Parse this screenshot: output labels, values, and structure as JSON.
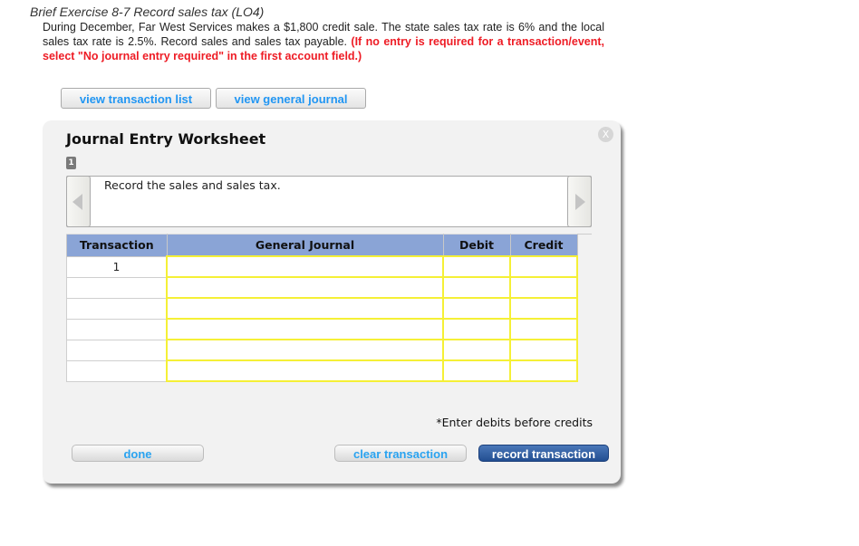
{
  "exercise": {
    "title": "Brief Exercise 8-7 Record sales tax (LO4)",
    "body": "During December, Far West Services makes a $1,800 credit sale. The state sales tax rate is 6% and the local sales tax rate is 2.5%. Record sales and sales tax payable.",
    "instruction": "(If no entry is required for a transaction/event, select \"No journal entry required\" in the first account field.)",
    "instruction_color": "#ee1c25"
  },
  "top_buttons": {
    "view_transaction_list": "view transaction list",
    "view_general_journal": "view general journal"
  },
  "worksheet": {
    "title": "Journal Entry Worksheet",
    "close_icon": "X",
    "step_badge": "1",
    "nav_text": "Record the sales and sales tax.",
    "table": {
      "headers": [
        "Transaction",
        "General Journal",
        "Debit",
        "Credit"
      ],
      "header_color": "#8aa4d6",
      "rows": [
        {
          "transaction": "1",
          "account": "",
          "debit": "",
          "credit": ""
        },
        {
          "transaction": "",
          "account": "",
          "debit": "",
          "credit": ""
        },
        {
          "transaction": "",
          "account": "",
          "debit": "",
          "credit": ""
        },
        {
          "transaction": "",
          "account": "",
          "debit": "",
          "credit": ""
        },
        {
          "transaction": "",
          "account": "",
          "debit": "",
          "credit": ""
        },
        {
          "transaction": "",
          "account": "",
          "debit": "",
          "credit": ""
        }
      ]
    },
    "hint": "*Enter debits before credits",
    "buttons": {
      "done": "done",
      "clear": "clear transaction",
      "record": "record transaction"
    }
  }
}
